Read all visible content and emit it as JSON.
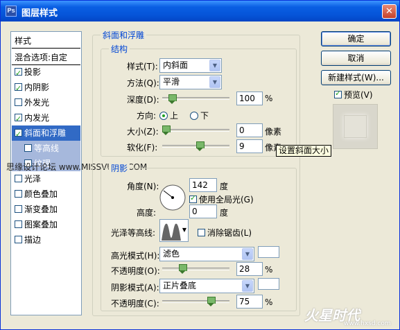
{
  "window": {
    "title": "图层样式",
    "close_glyph": "✕",
    "app_icon_text": "Ps"
  },
  "style_list": {
    "header": "样式",
    "blend_options": "混合选项:自定",
    "items": [
      {
        "label": "投影",
        "checked": true
      },
      {
        "label": "内阴影",
        "checked": true
      },
      {
        "label": "外发光",
        "checked": false
      },
      {
        "label": "内发光",
        "checked": true
      },
      {
        "label": "斜面和浮雕",
        "checked": true,
        "selected": true
      },
      {
        "label": "等高线",
        "checked": false
      },
      {
        "label": "纹理",
        "checked": false
      },
      {
        "label": "光泽",
        "checked": false
      },
      {
        "label": "颜色叠加",
        "checked": false
      },
      {
        "label": "渐变叠加",
        "checked": false
      },
      {
        "label": "图案叠加",
        "checked": false
      },
      {
        "label": "描边",
        "checked": false
      }
    ]
  },
  "bevel": {
    "title": "斜面和浮雕",
    "structure": {
      "title": "结构",
      "style_label": "样式(T):",
      "style_value": "内斜面",
      "technique_label": "方法(Q):",
      "technique_value": "平滑",
      "depth_label": "深度(D):",
      "depth_value": "100",
      "depth_unit": "%",
      "depth_level": 0.1,
      "direction_label": "方向:",
      "direction_up": "上",
      "direction_down": "下",
      "direction_selected": "上",
      "size_label": "大小(Z):",
      "size_value": "0",
      "size_unit": "像素",
      "size_level": 0,
      "soften_label": "软化(F):",
      "soften_value": "9",
      "soften_unit": "像素",
      "soften_level": 0.56
    },
    "shading": {
      "title": "阴影",
      "angle_label": "角度(N):",
      "angle_value": "142",
      "angle_unit": "度",
      "global_light_label": "使用全局光(G)",
      "global_light_checked": true,
      "altitude_label": "高度:",
      "altitude_value": "0",
      "altitude_unit": "度",
      "gloss_contour_label": "光泽等高线:",
      "antialias_label": "消除锯齿(L)",
      "antialias_checked": false,
      "highlight_mode_label": "高光模式(H):",
      "highlight_mode_value": "滤色",
      "highlight_color": "#ffffff",
      "highlight_opacity_label": "不透明度(O):",
      "highlight_opacity_value": "28",
      "highlight_opacity_unit": "%",
      "highlight_opacity_level": 0.28,
      "shadow_mode_label": "阴影模式(A):",
      "shadow_mode_value": "正片叠底",
      "shadow_color": "#ffffff",
      "shadow_opacity_label": "不透明度(C):",
      "shadow_opacity_value": "75",
      "shadow_opacity_unit": "%",
      "shadow_opacity_level": 0.75
    }
  },
  "tooltip": "设置斜面大小",
  "buttons": {
    "ok": "确定",
    "cancel": "取消",
    "new_style": "新建样式(W)...",
    "preview_label": "预览(V)",
    "preview_checked": true
  },
  "watermark": {
    "overlay": "思缘设计论坛 www.MISSVUAN.COM",
    "brand": "火星时代",
    "url": "www.hxsd.com"
  },
  "colors": {
    "titlebar": "#0554d8",
    "selection": "#316ac5",
    "group_title": "#0046d5",
    "dialog_bg": "#ece9d8"
  }
}
